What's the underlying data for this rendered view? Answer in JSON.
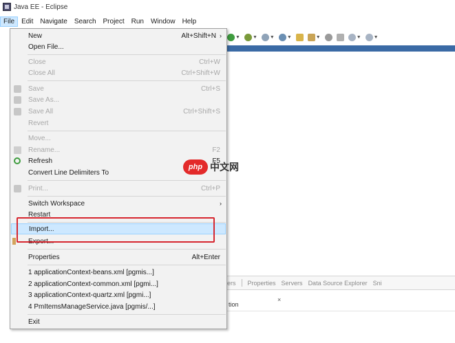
{
  "window": {
    "title": "Java EE - Eclipse"
  },
  "menubar": {
    "items": [
      {
        "label": "File"
      },
      {
        "label": "Edit"
      },
      {
        "label": "Navigate"
      },
      {
        "label": "Search"
      },
      {
        "label": "Project"
      },
      {
        "label": "Run"
      },
      {
        "label": "Window"
      },
      {
        "label": "Help"
      }
    ]
  },
  "file_menu": {
    "new": {
      "label": "New",
      "shortcut": "Alt+Shift+N"
    },
    "open_file": {
      "label": "Open File..."
    },
    "close": {
      "label": "Close",
      "shortcut": "Ctrl+W"
    },
    "close_all": {
      "label": "Close All",
      "shortcut": "Ctrl+Shift+W"
    },
    "save": {
      "label": "Save",
      "shortcut": "Ctrl+S"
    },
    "save_as": {
      "label": "Save As..."
    },
    "save_all": {
      "label": "Save All",
      "shortcut": "Ctrl+Shift+S"
    },
    "revert": {
      "label": "Revert"
    },
    "move": {
      "label": "Move..."
    },
    "rename": {
      "label": "Rename...",
      "shortcut": "F2"
    },
    "refresh": {
      "label": "Refresh",
      "shortcut": "F5"
    },
    "convert": {
      "label": "Convert Line Delimiters To"
    },
    "print": {
      "label": "Print...",
      "shortcut": "Ctrl+P"
    },
    "switch_workspace": {
      "label": "Switch Workspace"
    },
    "restart": {
      "label": "Restart"
    },
    "import": {
      "label": "Import..."
    },
    "export": {
      "label": "Export..."
    },
    "properties": {
      "label": "Properties",
      "shortcut": "Alt+Enter"
    },
    "recent": [
      {
        "label": "1 applicationContext-beans.xml  [pgmis...]"
      },
      {
        "label": "2 applicationContext-common.xml  [pgmi...]"
      },
      {
        "label": "3 applicationContext-quartz.xml  [pgmi...]"
      },
      {
        "label": "4 PmItemsManageService.java  [pgmis/...]"
      }
    ],
    "exit": {
      "label": "Exit"
    }
  },
  "bottom_panel": {
    "tabs": [
      {
        "label": "ers"
      },
      {
        "label": "Properties"
      },
      {
        "label": "Servers"
      },
      {
        "label": "Data Source Explorer"
      },
      {
        "label": "Sni"
      }
    ],
    "column": "tion"
  },
  "watermark": {
    "logo": "php",
    "text": "中文网"
  },
  "colors": {
    "highlight": "#cde8ff",
    "annotation": "#d6252e",
    "accent_band": "#3a6aa5"
  }
}
